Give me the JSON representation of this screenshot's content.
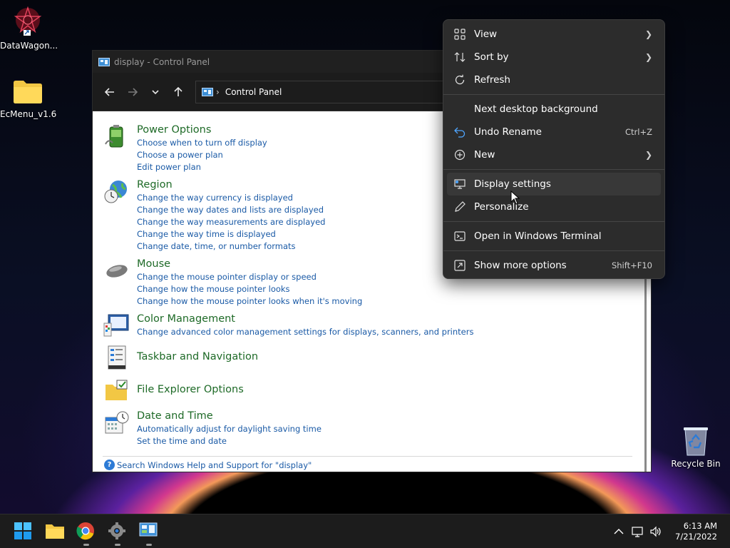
{
  "desktop": {
    "icons": [
      {
        "label": "DataWagon..."
      },
      {
        "label": "EcMenu_v1.6"
      }
    ],
    "recycle_bin": {
      "label": "Recycle Bin"
    }
  },
  "window": {
    "title": "display - Control Panel",
    "address": "Control Panel",
    "groups": [
      {
        "title": "Power Options",
        "links": [
          "Choose when to turn off display",
          "Choose a power plan",
          "Edit power plan"
        ]
      },
      {
        "title": "Region",
        "links": [
          "Change the way currency is displayed",
          "Change the way dates and lists are displayed",
          "Change the way measurements are displayed",
          "Change the way time is displayed",
          "Change date, time, or number formats"
        ]
      },
      {
        "title": "Mouse",
        "links": [
          "Change the mouse pointer display or speed",
          "Change how the mouse pointer looks",
          "Change how the mouse pointer looks when it's moving"
        ]
      },
      {
        "title": "Color Management",
        "links": [
          "Change advanced color management settings for displays, scanners, and printers"
        ]
      },
      {
        "title": "Taskbar and Navigation",
        "links": []
      },
      {
        "title": "File Explorer Options",
        "links": []
      },
      {
        "title": "Date and Time",
        "links": [
          "Automatically adjust for daylight saving time",
          "Set the time and date"
        ]
      }
    ],
    "footer": "Search Windows Help and Support for \"display\""
  },
  "context_menu": {
    "items": [
      {
        "label": "View",
        "icon": "grid-icon",
        "submenu": true
      },
      {
        "label": "Sort by",
        "icon": "sort-icon",
        "submenu": true
      },
      {
        "label": "Refresh",
        "icon": "refresh-icon"
      },
      {
        "label": "Next desktop background"
      },
      {
        "label": "Undo Rename",
        "icon": "undo-icon",
        "shortcut": "Ctrl+Z"
      },
      {
        "label": "New",
        "icon": "plus-circle-icon",
        "submenu": true
      },
      {
        "label": "Display settings",
        "icon": "display-icon",
        "hovered": true
      },
      {
        "label": "Personalize",
        "icon": "pen-icon"
      },
      {
        "label": "Open in Windows Terminal",
        "icon": "terminal-icon"
      },
      {
        "label": "Show more options",
        "icon": "expand-icon",
        "shortcut": "Shift+F10"
      }
    ]
  },
  "taskbar": {
    "time": "6:13 AM",
    "date": "7/21/2022"
  },
  "colors": {
    "link": "#1a5aa6",
    "group_title": "#1e6a27",
    "menu_bg": "#2c2c2c",
    "taskbar_bg": "#1c1c1c",
    "accent": "#0078d4"
  }
}
